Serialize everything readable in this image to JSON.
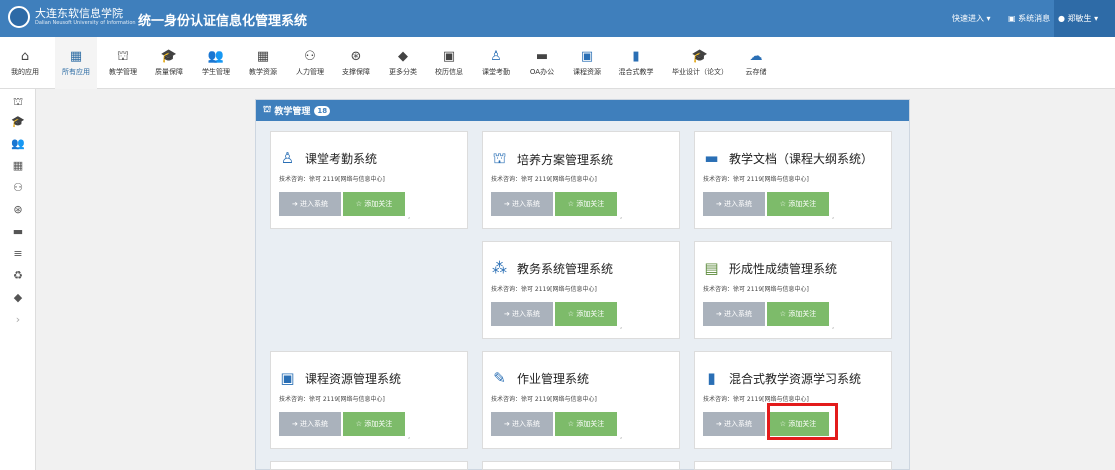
{
  "header": {
    "logo_cn": "大连东软信息学院",
    "logo_en": "Dalian Neusoft University of Information",
    "title": "统一身份认证信息化管理系统",
    "quick_entry": "快速进入 ▾",
    "messages": "系统消息",
    "user": "郑敏生 ▾"
  },
  "nav": {
    "items": [
      {
        "icon": "home-icon",
        "glyph": "⌂",
        "label": "我的应用"
      },
      {
        "icon": "grid-icon",
        "glyph": "▦",
        "label": "所有应用"
      },
      {
        "icon": "bank-icon",
        "glyph": "⛫",
        "label": "教学管理"
      },
      {
        "icon": "mortarboard-icon",
        "glyph": "🎓",
        "label": "质量保障"
      },
      {
        "icon": "users-icon",
        "glyph": "👥",
        "label": "学生管理"
      },
      {
        "icon": "blocks-icon",
        "glyph": "▦",
        "label": "教学资源"
      },
      {
        "icon": "sitemap-icon",
        "glyph": "⚇",
        "label": "人力管理"
      },
      {
        "icon": "support-icon",
        "glyph": "⊛",
        "label": "支撑保障"
      },
      {
        "icon": "tag-icon",
        "glyph": "◆",
        "label": "更多分类"
      },
      {
        "icon": "calendar-icon",
        "glyph": "▣",
        "label": "校历信息"
      },
      {
        "icon": "attendance-icon",
        "glyph": "♙",
        "label": "课堂考勤"
      },
      {
        "icon": "briefcase-icon",
        "glyph": "▬",
        "label": "OA办公"
      },
      {
        "icon": "course-resource-icon",
        "glyph": "▣",
        "label": "课程资源"
      },
      {
        "icon": "book-icon",
        "glyph": "▮",
        "label": "混合式教学"
      },
      {
        "icon": "graduation-icon",
        "glyph": "🎓",
        "label": "毕业设计（论文）"
      },
      {
        "icon": "cloud-icon",
        "glyph": "☁",
        "label": "云存储"
      }
    ]
  },
  "sidebar": {
    "icons": [
      "bank-icon",
      "mortarboard-icon",
      "users-icon",
      "blocks-icon",
      "sitemap-icon",
      "support-icon",
      "briefcase-icon",
      "list-icon",
      "share-icon",
      "tag-icon",
      "chevron-right-icon"
    ],
    "glyphs": [
      "⛫",
      "🎓",
      "👥",
      "▦",
      "⚇",
      "⊛",
      "▬",
      "≡",
      "♻",
      "◆",
      "›"
    ]
  },
  "panel": {
    "title": "教学管理",
    "badge": "18"
  },
  "buttons": {
    "enter": "➔ 进入系统",
    "follow": "☆ 添加关注"
  },
  "cards": [
    {
      "name": "课堂考勤系统",
      "icon": "attendance-icon",
      "glyph": "♙",
      "color": "#2a6fb5",
      "contact": "技术咨询：徐可 2119[网络与信息中心]"
    },
    {
      "name": "培养方案管理系统",
      "icon": "bank-icon",
      "glyph": "⛫",
      "color": "#2a6fb5",
      "contact": "技术咨询：徐可 2119[网络与信息中心]"
    },
    {
      "name": "教学文档（课程大纲系统）",
      "icon": "folder-icon",
      "glyph": "▬",
      "color": "#2a6fb5",
      "contact": "技术咨询：徐可 2119[网络与信息中心]"
    },
    {
      "name": "教务系统管理系统",
      "icon": "network-icon",
      "glyph": "⁂",
      "color": "#2a6fb5",
      "contact": "技术咨询：徐可 2119[网络与信息中心]"
    },
    {
      "name": "形成性成绩管理系统",
      "icon": "add-record-icon",
      "glyph": "▤",
      "color": "#5b8a3a",
      "contact": "技术咨询：徐可 2119[网络与信息中心]"
    },
    {
      "name": "课程资源管理系统",
      "icon": "course-resource-icon",
      "glyph": "▣",
      "color": "#2a6fb5",
      "contact": "技术咨询：徐可 2119[网络与信息中心]"
    },
    {
      "name": "作业管理系统",
      "icon": "edit-icon",
      "glyph": "✎",
      "color": "#2a6fb5",
      "contact": "技术咨询：徐可 2119[网络与信息中心]"
    },
    {
      "name": "混合式教学资源学习系统",
      "icon": "book-icon",
      "glyph": "▮",
      "color": "#2a6fb5",
      "contact": "技术咨询：徐可 2119[网络与信息中心]"
    }
  ],
  "colors": {
    "brand": "#3f7fbc",
    "follow": "#7dbb6a",
    "enter": "#aab2bc",
    "highlight": "#e31b1b"
  }
}
